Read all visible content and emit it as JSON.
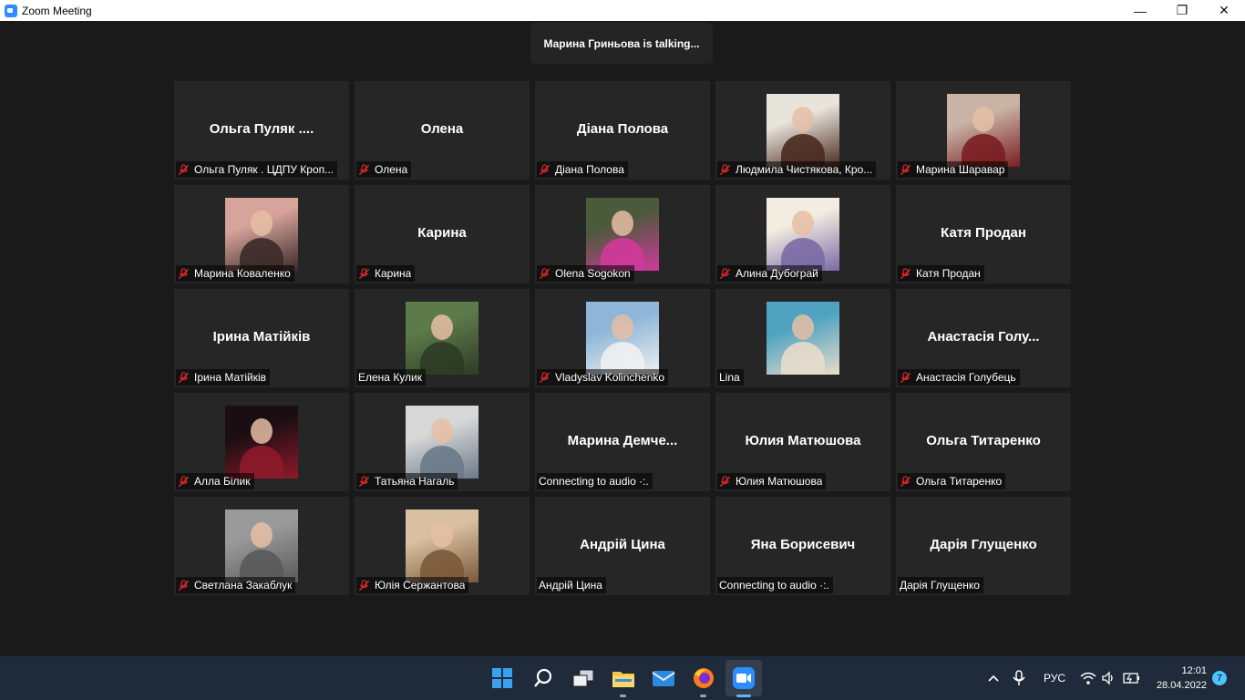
{
  "window": {
    "title": "Zoom Meeting"
  },
  "window_controls": {
    "minimize": "—",
    "maximize": "❐",
    "close": "✕"
  },
  "talking_banner": "Марина Гриньова is talking...",
  "participants": [
    {
      "name": "Ольга  Пуляк  ....",
      "label": "Ольга Пуляк . ЦДПУ Кроп...",
      "muted": true,
      "video": false
    },
    {
      "name": "Олена",
      "label": "Олена",
      "muted": true,
      "video": false
    },
    {
      "name": "Діана Полова",
      "label": "Діана Полова",
      "muted": true,
      "video": false
    },
    {
      "name": "",
      "label": "Людмила Чистякова, Кро...",
      "muted": true,
      "video": true,
      "avatar_colors": [
        "#e8e4dc",
        "#4a2a20"
      ]
    },
    {
      "name": "",
      "label": "Марина Шараваp",
      "muted": true,
      "video": true,
      "avatar_colors": [
        "#c9b3a5",
        "#7a1e22"
      ]
    },
    {
      "name": "",
      "label": "Марина Коваленко",
      "muted": true,
      "video": true,
      "avatar_colors": [
        "#d6a49b",
        "#3b2a28"
      ]
    },
    {
      "name": "Карина",
      "label": "Карина",
      "muted": true,
      "video": false
    },
    {
      "name": "",
      "label": "Olena Sogokon",
      "muted": true,
      "video": true,
      "avatar_colors": [
        "#4a5a3a",
        "#d03a9a"
      ]
    },
    {
      "name": "",
      "label": "Алина Дубограй",
      "muted": true,
      "video": true,
      "avatar_colors": [
        "#f2ede0",
        "#7a6aa5"
      ]
    },
    {
      "name": "Катя Продан",
      "label": "Катя Продан",
      "muted": true,
      "video": false
    },
    {
      "name": "Ірина Матійків",
      "label": "Ірина Матійків",
      "muted": true,
      "video": false
    },
    {
      "name": "",
      "label": "Елена Кулик",
      "muted": false,
      "video": true,
      "avatar_colors": [
        "#5d7a4a",
        "#2e3b26"
      ]
    },
    {
      "name": "",
      "label": "Vladyslav Kolinchenko",
      "muted": true,
      "video": true,
      "avatar_colors": [
        "#8fb6d8",
        "#f0f0f0"
      ]
    },
    {
      "name": "",
      "label": "Lina",
      "muted": false,
      "video": true,
      "avatar_colors": [
        "#4fa3c0",
        "#e8dccb"
      ]
    },
    {
      "name": "Анастасія Голу...",
      "label": "Анастасія Голубець",
      "muted": true,
      "video": false
    },
    {
      "name": "",
      "label": "Алла Білик",
      "muted": true,
      "video": true,
      "avatar_colors": [
        "#1a0e12",
        "#8e1a2a"
      ]
    },
    {
      "name": "",
      "label": "Татьяна Нагаль",
      "muted": true,
      "video": true,
      "avatar_colors": [
        "#d8d8d8",
        "#6a7a8a"
      ]
    },
    {
      "name": "Марина  Демче...",
      "label": "Connecting to audio ·:.",
      "muted": false,
      "video": false
    },
    {
      "name": "Юлия Матюшова",
      "label": "Юлия Матюшова",
      "muted": true,
      "video": false
    },
    {
      "name": "Ольга Титаренко",
      "label": "Ольга Титаренко",
      "muted": true,
      "video": false
    },
    {
      "name": "",
      "label": "Светлана Закаблук",
      "muted": true,
      "video": true,
      "avatar_colors": [
        "#9a9a9a",
        "#5a5a5a"
      ]
    },
    {
      "name": "",
      "label": "Юлія Сержантова",
      "muted": true,
      "video": true,
      "avatar_colors": [
        "#d9c0a0",
        "#7a5a3a"
      ]
    },
    {
      "name": "Андрій Цина",
      "label": "Андрій Цина",
      "muted": false,
      "video": false
    },
    {
      "name": "Яна Борисевич",
      "label": "Connecting to audio ·:.",
      "muted": false,
      "video": false
    },
    {
      "name": "Дарія Глущенко",
      "label": "Дарія Глущенко",
      "muted": false,
      "video": false
    }
  ],
  "taskbar": {
    "apps": [
      "start-icon",
      "search-icon",
      "task-view-icon",
      "file-explorer-icon",
      "mail-icon",
      "firefox-icon",
      "zoom-icon"
    ],
    "language": "РУС",
    "time": "12:01",
    "date": "28.04.2022",
    "notifications": "7"
  },
  "colors": {
    "background": "#1a1a1a",
    "tile": "#262626",
    "mute_red": "#e02828",
    "accent": "#2D8CFF"
  }
}
